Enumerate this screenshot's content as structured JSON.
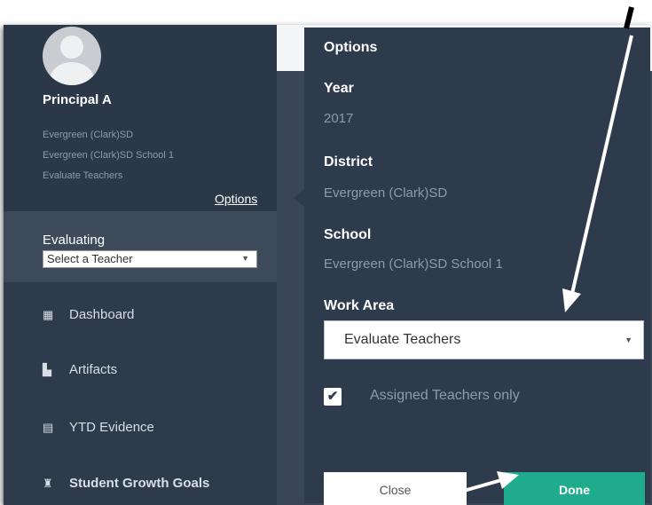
{
  "sidebar": {
    "user_name": "Principal A",
    "info_lines": [
      "Evergreen (Clark)SD",
      "Evergreen (Clark)SD School 1",
      "Evaluate Teachers"
    ],
    "options_link": "Options",
    "evaluating_label": "Evaluating",
    "teacher_select": "Select a Teacher",
    "nav": [
      {
        "label": "Dashboard",
        "icon": "dashboard-grid-icon"
      },
      {
        "label": "Artifacts",
        "icon": "artifacts-icon"
      },
      {
        "label": "YTD Evidence",
        "icon": "table-icon"
      },
      {
        "label": "Student Growth Goals",
        "icon": "student-icon"
      }
    ]
  },
  "options": {
    "title": "Options",
    "year_label": "Year",
    "year_value": "2017",
    "district_label": "District",
    "district_value": "Evergreen (Clark)SD",
    "school_label": "School",
    "school_value": "Evergreen (Clark)SD School 1",
    "work_area_label": "Work Area",
    "work_area_value": "Evaluate Teachers",
    "assigned_only_label": "Assigned Teachers only",
    "assigned_only_checked": true,
    "close_label": "Close",
    "done_label": "Done"
  },
  "colors": {
    "sidebar_bg": "#2e3b4c",
    "done_green": "#1fac8c",
    "annotation": "#ffffff"
  }
}
